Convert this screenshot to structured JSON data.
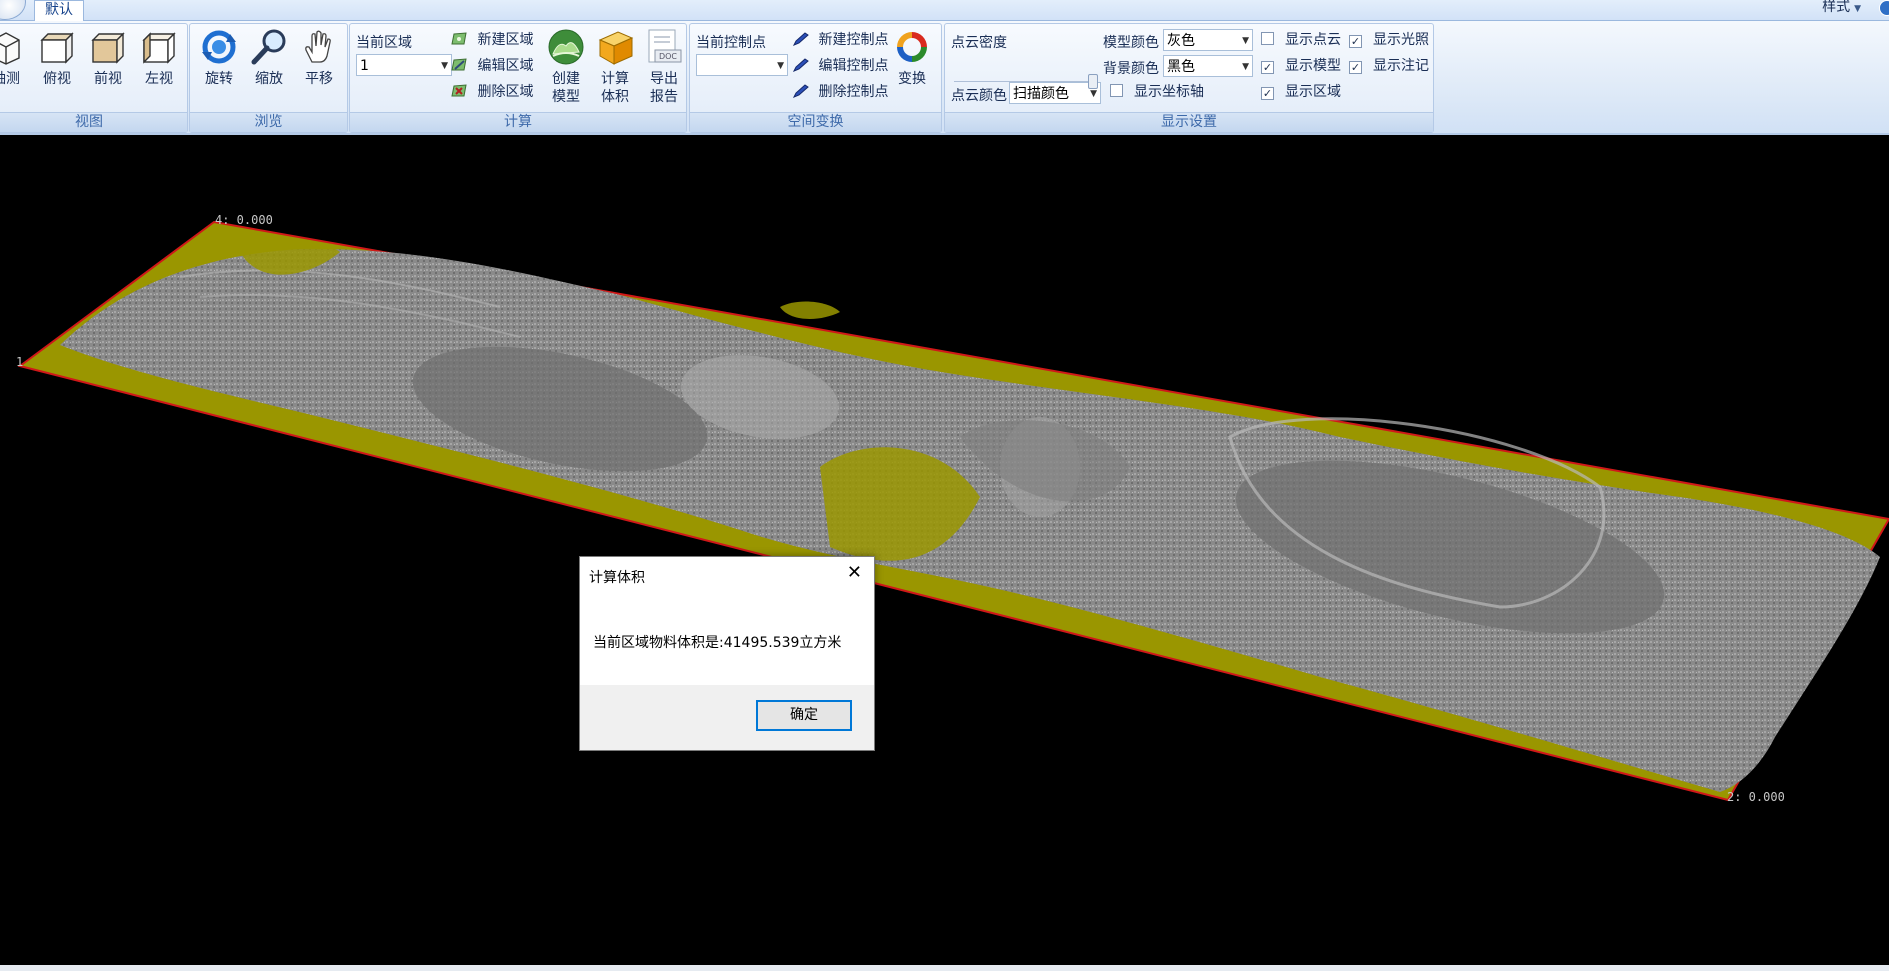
{
  "tabs": {
    "active": "默认"
  },
  "top_right": {
    "style_menu": "样式"
  },
  "groups": {
    "view": {
      "label": "视图",
      "buttons": [
        {
          "label": "轴测",
          "icon": "iso-cube-icon"
        },
        {
          "label": "俯视",
          "icon": "top-cube-icon"
        },
        {
          "label": "前视",
          "icon": "front-cube-icon"
        },
        {
          "label": "左视",
          "icon": "left-cube-icon"
        }
      ]
    },
    "browse": {
      "label": "浏览",
      "buttons": [
        {
          "label": "旋转",
          "icon": "rotate-icon"
        },
        {
          "label": "缩放",
          "icon": "zoom-magnifier-icon"
        },
        {
          "label": "平移",
          "icon": "pan-hand-icon"
        }
      ]
    },
    "compute": {
      "label": "计算",
      "current_region_label": "当前区域",
      "current_region_value": "1",
      "new_region": "新建区域",
      "edit_region": "编辑区域",
      "delete_region": "删除区域",
      "create_model_l1": "创建",
      "create_model_l2": "模型",
      "calc_volume_l1": "计算",
      "calc_volume_l2": "体积",
      "export_report_l1": "导出",
      "export_report_l2": "报告",
      "doc_icon_text": "DOC"
    },
    "transform": {
      "label": "空间变换",
      "current_ctrl_label": "当前控制点",
      "current_ctrl_value": "",
      "new_ctrl": "新建控制点",
      "edit_ctrl": "编辑控制点",
      "delete_ctrl": "删除控制点",
      "transform_btn": "变换"
    },
    "display": {
      "label": "显示设置",
      "density_label": "点云密度",
      "model_color_label": "模型颜色",
      "model_color_value": "灰色",
      "bg_color_label": "背景颜色",
      "bg_color_value": "黑色",
      "cloud_color_label": "点云颜色",
      "cloud_color_value": "扫描颜色",
      "show_axes": {
        "label": "显示坐标轴",
        "checked": false
      },
      "show_cloud": {
        "label": "显示点云",
        "checked": false
      },
      "show_model": {
        "label": "显示模型",
        "checked": true
      },
      "show_region": {
        "label": "显示区域",
        "checked": true
      },
      "show_light": {
        "label": "显示光照",
        "checked": true
      },
      "show_note": {
        "label": "显示注记",
        "checked": true
      }
    }
  },
  "viewport": {
    "corner_label_top": "4: 0.000",
    "corner_label_left": "1",
    "corner_label_bottom": "2: 0.000",
    "background": "#000000",
    "terrain_color": "#8c8c8c",
    "region_color": "#9a9600",
    "boundary_color": "#d01818"
  },
  "dialog": {
    "title": "计算体积",
    "message": "当前区域物料体积是:41495.539立方米",
    "ok": "确定"
  }
}
